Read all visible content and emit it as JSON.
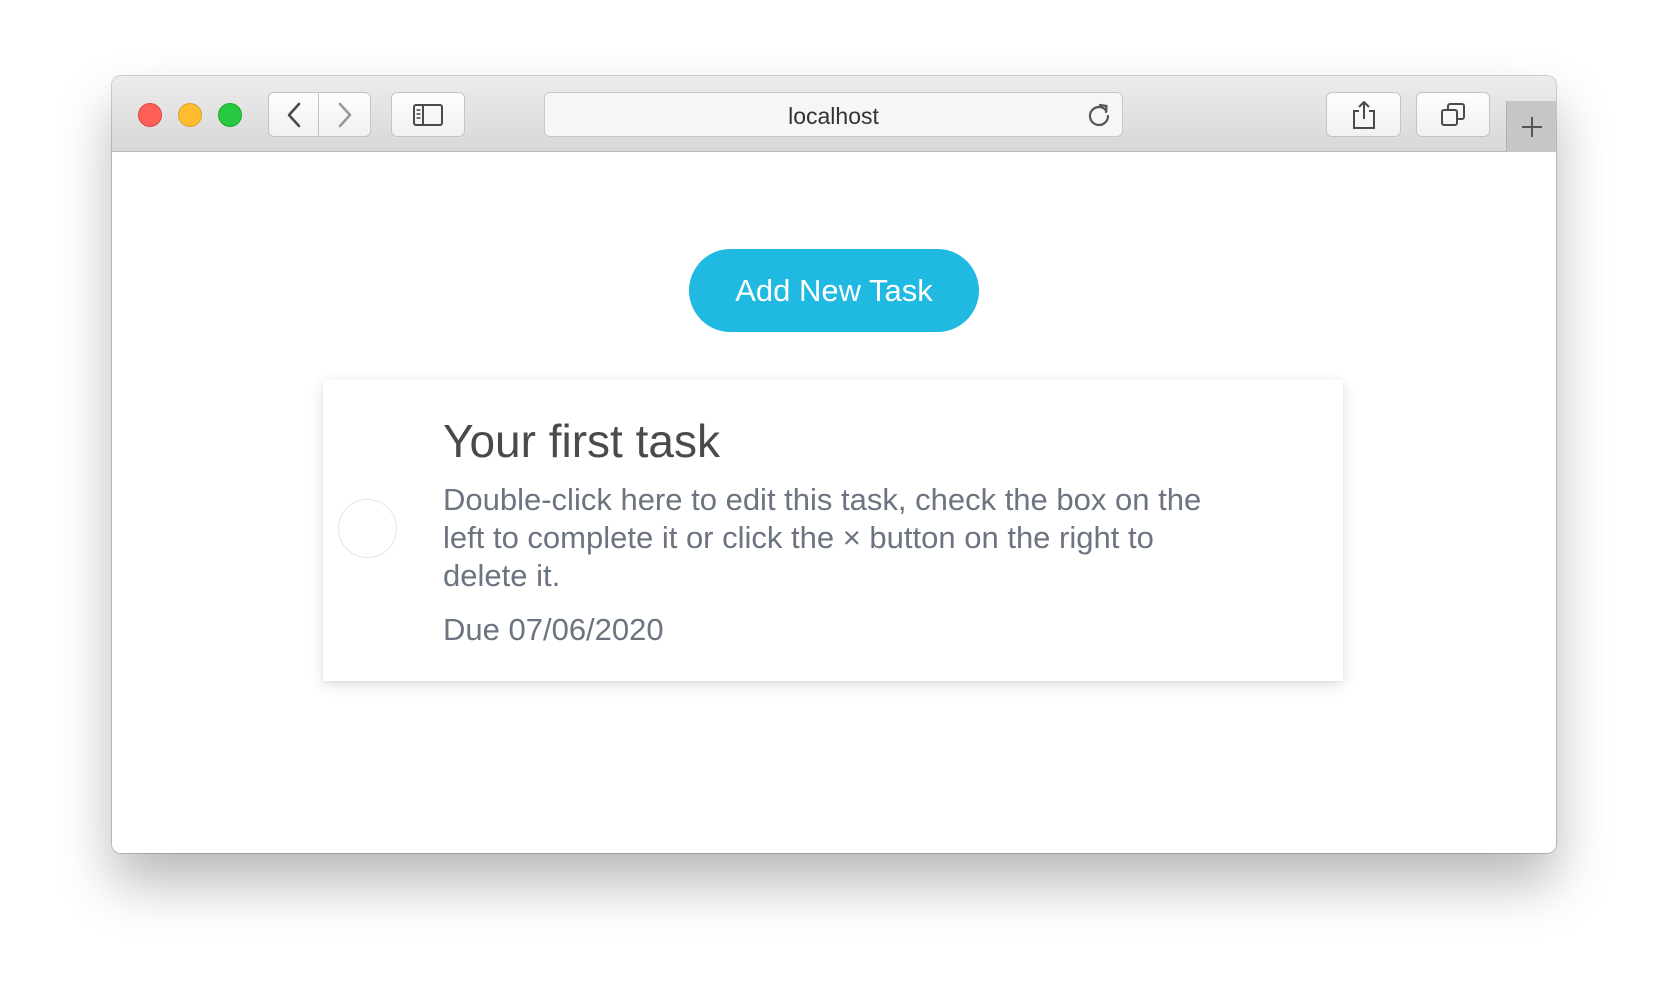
{
  "browser": {
    "url": "localhost",
    "icons": {
      "back": "chevron-left-icon",
      "forward": "chevron-right-icon",
      "sidebar": "sidebar-icon",
      "reload": "reload-icon",
      "share": "share-icon",
      "tabs": "tabs-overview-icon",
      "new_tab": "plus-icon"
    },
    "traffic_colors": {
      "close": "#fe5f57",
      "minimize": "#febc2e",
      "maximize": "#28c840"
    }
  },
  "page": {
    "add_button_label": "Add New Task",
    "accent_color": "#1fb9e1",
    "tasks": [
      {
        "title": "Your first task",
        "description": "Double-click here to edit this task, check the box on the left to complete it or click the × button on the right to delete it.",
        "due": "Due 07/06/2020",
        "completed": false
      }
    ]
  }
}
